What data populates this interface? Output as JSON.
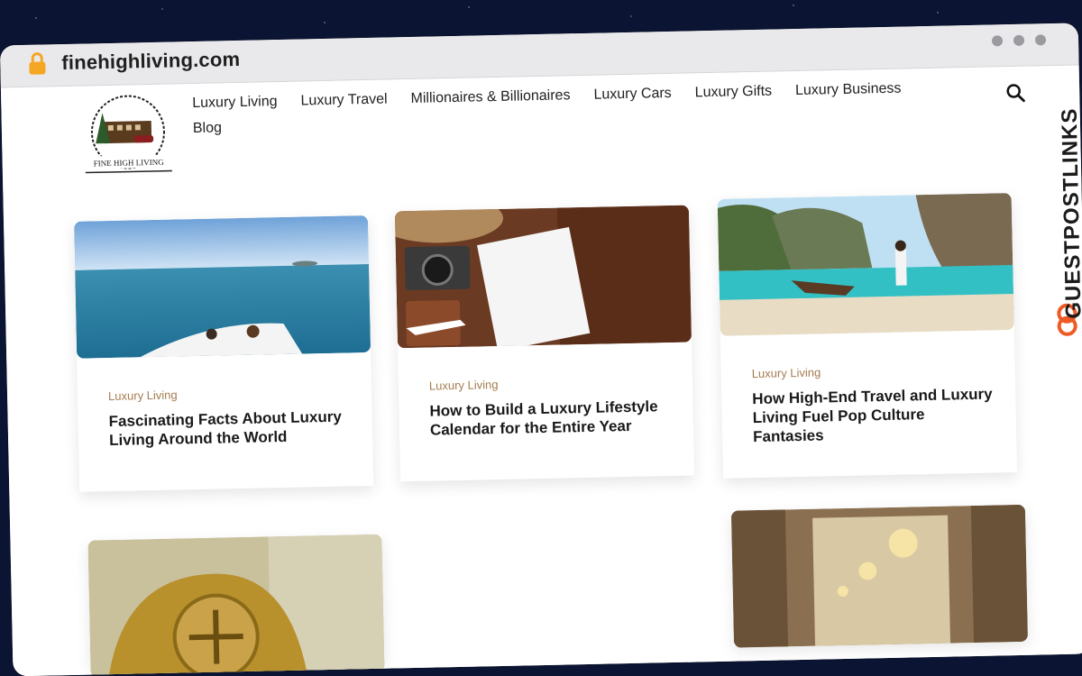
{
  "browser": {
    "url": "finehighliving.com"
  },
  "site": {
    "logo_text": "FINE HIGH LIVING",
    "nav": [
      "Luxury Living",
      "Luxury Travel",
      "Millionaires & Billionaires",
      "Luxury Cars",
      "Luxury Gifts",
      "Luxury Business",
      "Blog"
    ]
  },
  "side_brand": "GUESTPOSTLINKS",
  "posts": [
    {
      "category": "Luxury Living",
      "title": "Fascinating Facts About Luxury Living Around the World"
    },
    {
      "category": "Luxury Living",
      "title": "How to Build a Luxury Lifestyle Calendar for the Entire Year"
    },
    {
      "category": "Luxury Living",
      "title": "How High-End Travel and Luxury Living Fuel Pop Culture Fantasies"
    }
  ],
  "colors": {
    "accent": "#a57c50",
    "brand": "#ef5a24"
  }
}
